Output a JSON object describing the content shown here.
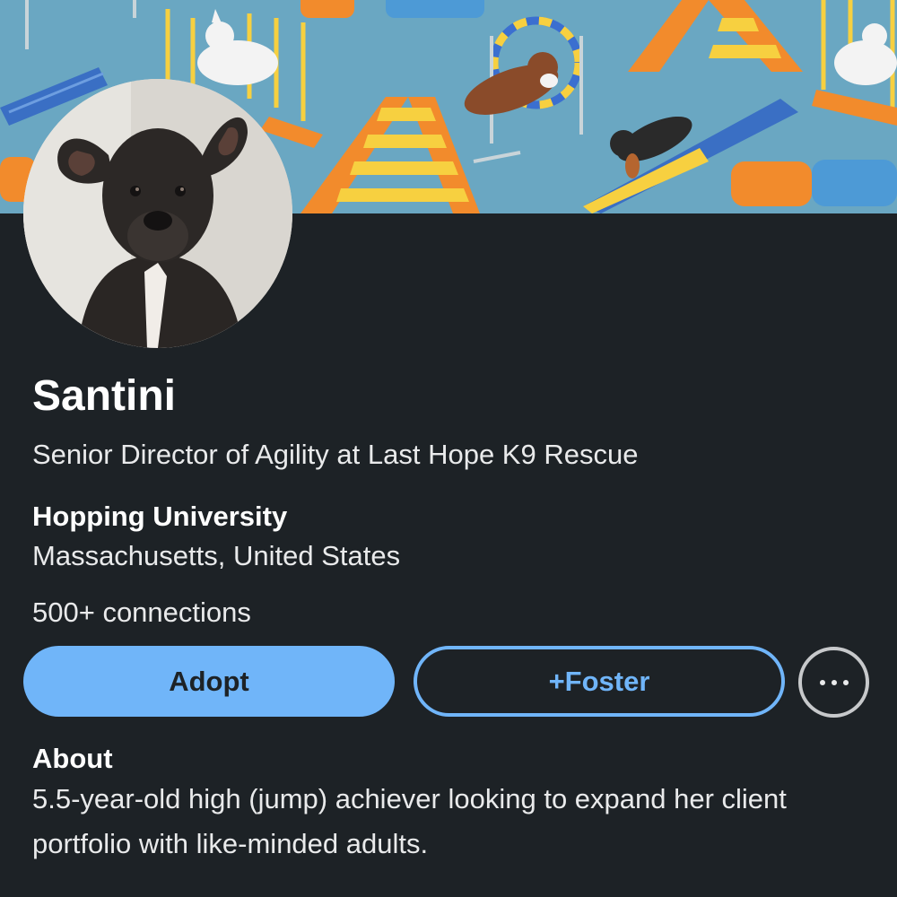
{
  "profile": {
    "name": "Santini",
    "headline": "Senior Director of Agility at Last Hope K9 Rescue",
    "school": "Hopping University",
    "location": "Massachusetts, United States",
    "connections": "500+ connections"
  },
  "actions": {
    "primary_label": "Adopt",
    "secondary_label": "+Foster",
    "more_icon": "more-horizontal-icon"
  },
  "about": {
    "heading": "About",
    "text": "5.5-year-old high (jump) achiever looking to expand her client portfolio with like-minded adults."
  },
  "colors": {
    "background": "#1d2226",
    "accent": "#70b5f9",
    "banner_sky": "#6aa7c2"
  }
}
